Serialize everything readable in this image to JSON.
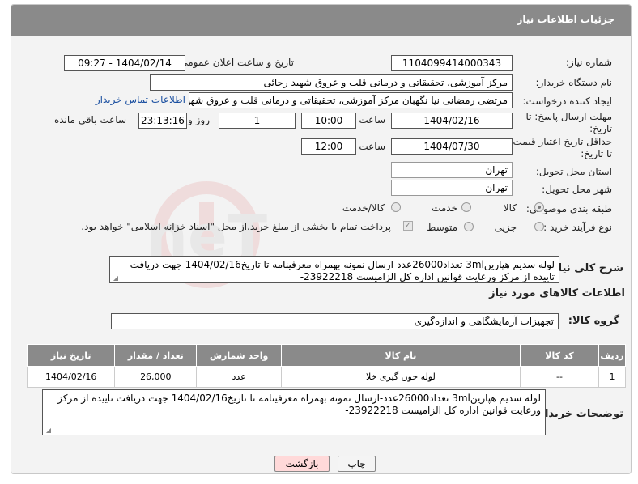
{
  "header": {
    "title": "جزئیات اطلاعات نیاز"
  },
  "need_number": {
    "label": "شماره نیاز:",
    "value": "1104099414000343"
  },
  "announce": {
    "label": "تاریخ و ساعت اعلان عمومی:",
    "value": "1404/02/14 - 09:27"
  },
  "buyer_org": {
    "label": "نام دستگاه خریدار:",
    "value": "مرکز آموزشی، تحقیقاتی و درمانی قلب و عروق شهید رجائی"
  },
  "requester": {
    "label": "ایجاد کننده درخواست:",
    "value": "مرتضی رمضانی نیا نگهبان مرکز آموزشی، تحقیقاتی و درمانی قلب و عروق شهید رجائی",
    "contact_link": "اطلاعات تماس خریدار"
  },
  "reply_deadline": {
    "label_line1": "مهلت ارسال پاسخ: تا",
    "label_line2": "تاریخ:",
    "date": "1404/02/16",
    "time_label": "ساعت",
    "time": "10:00",
    "days": "1",
    "days_label": "روز و",
    "remaining": "23:13:16",
    "remaining_label": "ساعت باقی مانده"
  },
  "price_validity": {
    "label_line1": "حداقل تاریخ اعتبار قیمت:",
    "label_line2": "تا تاریخ:",
    "date": "1404/07/30",
    "time_label": "ساعت",
    "time": "12:00"
  },
  "province": {
    "label": "استان محل تحویل:",
    "value": "تهران"
  },
  "city": {
    "label": "شهر محل تحویل:",
    "value": "تهران"
  },
  "category": {
    "label": "طبقه بندی موضوعی:",
    "options": [
      "کالا",
      "خدمت",
      "کالا/خدمت"
    ],
    "selected": "کالا"
  },
  "purchase_type": {
    "label": "نوع فرآیند خرید :",
    "options": [
      "جزیی",
      "متوسط"
    ],
    "note": "پرداخت تمام یا بخشی از مبلغ خرید،از محل \"اسناد خزانه اسلامی\" خواهد بود."
  },
  "description": {
    "label": "شرح کلی نیاز:",
    "value": "لوله سدیم هپارین3ml تعداد26000عدد-ارسال نمونه بهمراه معرفینامه تا تاریخ1404/02/16 جهت دریافت تاییده از مرکز ورعایت قوانین اداره کل الزامیست 23922218-"
  },
  "goods_info": {
    "title": "اطلاعات کالاهای مورد نیاز"
  },
  "goods_group": {
    "label": "گروه کالا:",
    "value": "تجهیزات آزمایشگاهی و اندازه‌گیری"
  },
  "table": {
    "headers": [
      "ردیف",
      "کد کالا",
      "نام کالا",
      "واحد شمارش",
      "تعداد / مقدار",
      "تاریخ نیاز"
    ],
    "rows": [
      [
        "1",
        "--",
        "لوله خون گیری خلا",
        "عدد",
        "26,000",
        "1404/02/16"
      ]
    ]
  },
  "buyer_notes": {
    "label": "توضیحات خریدار:",
    "value": "لوله سدیم هپارین3ml تعداد26000عدد-ارسال نمونه بهمراه معرفینامه تا تاریخ1404/02/16 جهت دریافت تاییده از مرکز ورعایت قوانین اداره کل الزامیست 23922218-"
  },
  "buttons": {
    "print": "چاپ",
    "back": "بازگشت"
  },
  "watermark": {
    "text": "AriaTender.neT"
  }
}
